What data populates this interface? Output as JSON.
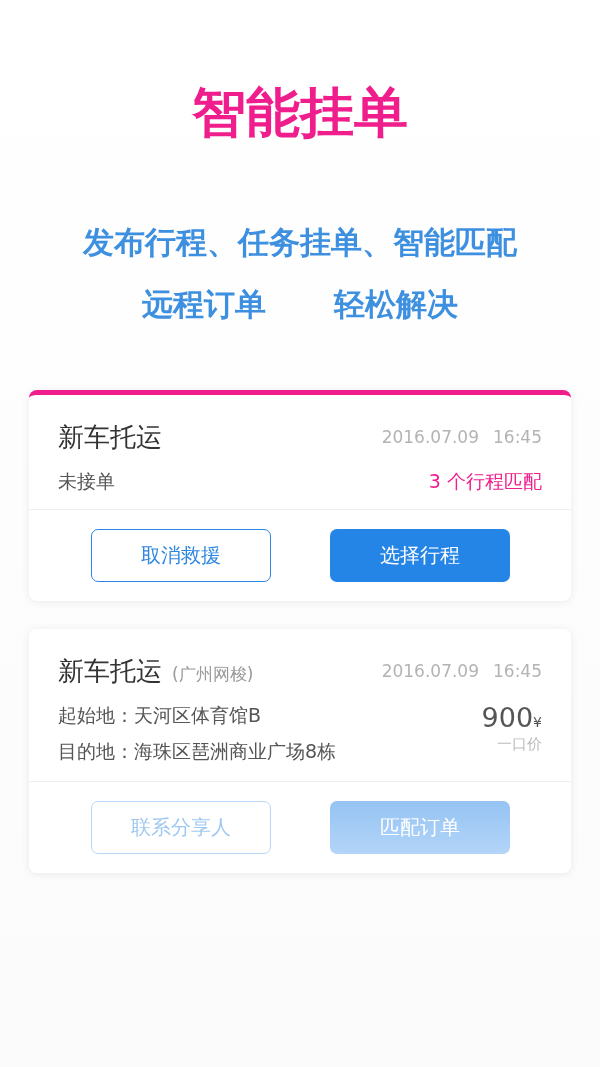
{
  "headline": "智能挂单",
  "tagline": {
    "line_1": "发布行程、任务挂单、智能匹配",
    "line_2": [
      "远程订单",
      "轻松解决"
    ]
  },
  "cards": [
    {
      "kind": "pending",
      "title": "新车托运",
      "date": "2016.07.09",
      "time": "16:45",
      "status": "未接单",
      "matches": "3 个行程匹配",
      "buttons": [
        {
          "label": "取消救援",
          "kind": "outline"
        },
        {
          "label": "选择行程",
          "kind": "solid"
        }
      ]
    },
    {
      "kind": "offer",
      "title": "新车托运",
      "note": "(广州网梭)",
      "date": "2016.07.09",
      "time": "16:45",
      "route": [
        "起始地：天河区体育馆B",
        "目的地：海珠区琶洲商业广场8栋"
      ],
      "price": "900",
      "currency": "¥",
      "price_note": "一口价",
      "buttons": [
        {
          "label": "联系分享人",
          "kind": "outline"
        },
        {
          "label": "匹配订单",
          "kind": "solid"
        }
      ]
    }
  ]
}
